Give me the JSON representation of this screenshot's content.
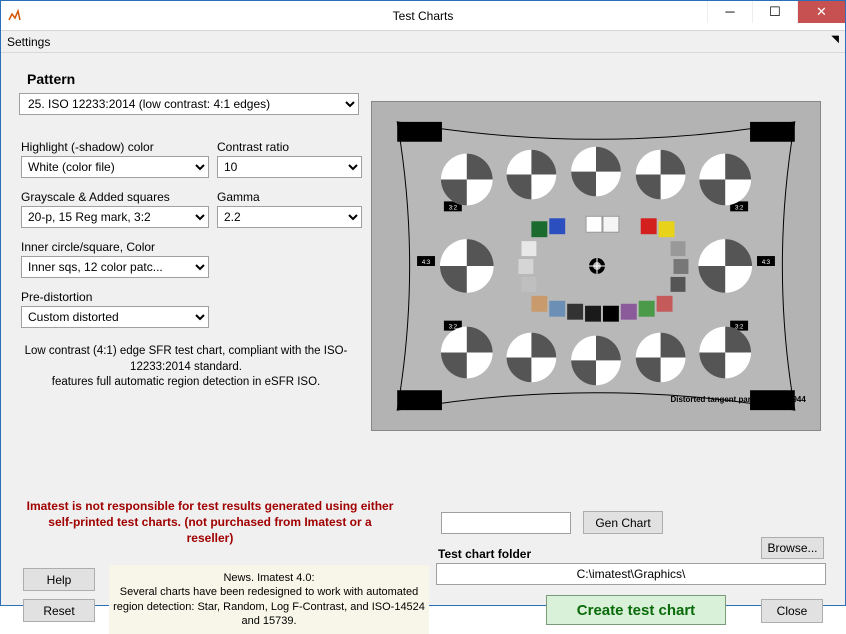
{
  "window": {
    "title": "Test Charts",
    "menu": {
      "settings": "Settings"
    }
  },
  "pattern": {
    "label": "Pattern",
    "selected": "25. ISO 12233:2014 (low contrast: 4:1 edges)"
  },
  "fields": {
    "highlight": {
      "label": "Highlight (-shadow) color",
      "value": "White  (color file)"
    },
    "contrast": {
      "label": "Contrast ratio",
      "value": "10"
    },
    "grayscale": {
      "label": "Grayscale & Added squares",
      "value": "20-p, 15 Reg mark, 3:2"
    },
    "gamma": {
      "label": "Gamma",
      "value": "2.2"
    },
    "inner": {
      "label": "Inner circle/square, Color",
      "value": "Inner sqs, 12 color patc..."
    },
    "predist": {
      "label": "Pre-distortion",
      "value": "Custom distorted"
    }
  },
  "description": "Low contrast (4:1) edge SFR test chart, compliant with the ISO-12233:2014 standard.\nfeatures full automatic region detection in eSFR ISO.",
  "preview_caption": "Distorted tangent parameter = 0.944",
  "warning": "Imatest is not responsible for test results generated using either self-printed test charts. (not purchased from Imatest or a reseller)",
  "buttons": {
    "help": "Help",
    "reset": "Reset",
    "gen_chart": "Gen Chart",
    "browse": "Browse...",
    "create": "Create test chart",
    "close": "Close"
  },
  "news": {
    "header": "News.   Imatest 4.0:",
    "body": "Several charts have been redesigned to work with automated region detection:  Star, Random, Log F-Contrast, and  ISO-14524 and 15739."
  },
  "folder": {
    "label": "Test chart folder",
    "value": "C:\\imatest\\Graphics\\"
  },
  "gen_input": ""
}
